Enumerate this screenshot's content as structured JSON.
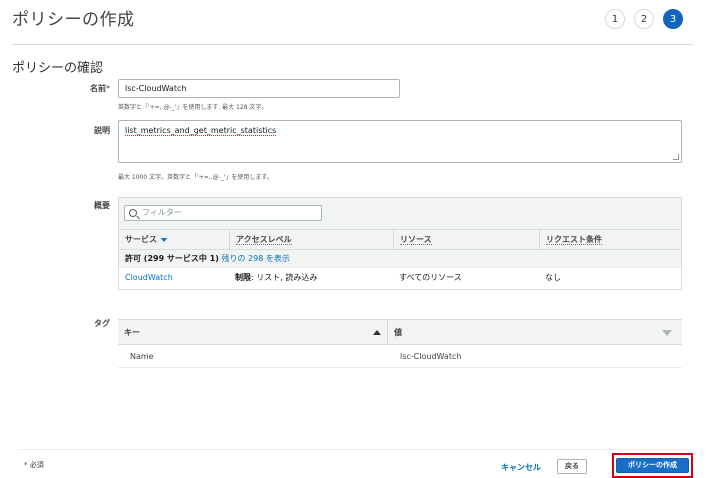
{
  "header": {
    "title": "ポリシーの作成",
    "steps": [
      "1",
      "2",
      "3"
    ],
    "active_step": "3"
  },
  "review": {
    "section_title": "ポリシーの確認",
    "name": {
      "label": "名前",
      "required_mark": "*",
      "value": "lsc-CloudWatch",
      "hint": "英数字と「'+=,.@-_'」を使用します. 最大 128 文字。"
    },
    "description": {
      "label": "説明",
      "value": "list_metrics_and_get_metric_statistics",
      "hint": "最大 1000 文字。英数字と「'+=,.@-_'」を使用します。"
    },
    "summary": {
      "label": "概要",
      "filter_placeholder": "フィルター",
      "columns": [
        "サービス",
        "アクセスレベル",
        "リソース",
        "リクエスト条件"
      ],
      "group_bold": "許可 (299 サービス中 1)",
      "group_link": "残りの 298 を表示",
      "rows": [
        {
          "service": "CloudWatch",
          "access_bold": "制限",
          "access_rest": ": リスト, 読み込み",
          "resource": "すべてのリソース",
          "condition": "なし"
        }
      ]
    },
    "tags": {
      "label": "タグ",
      "columns": [
        "キー",
        "値"
      ],
      "rows": [
        {
          "key": "Name",
          "value": "lsc-CloudWatch"
        }
      ]
    }
  },
  "footer": {
    "required_note": "* 必須",
    "cancel_label": "キャンセル",
    "back_label": "戻る",
    "create_label": "ポリシーの作成"
  },
  "colors": {
    "primary": "#1a6ec8",
    "link": "#0073bb",
    "highlight": "#d0021b"
  }
}
